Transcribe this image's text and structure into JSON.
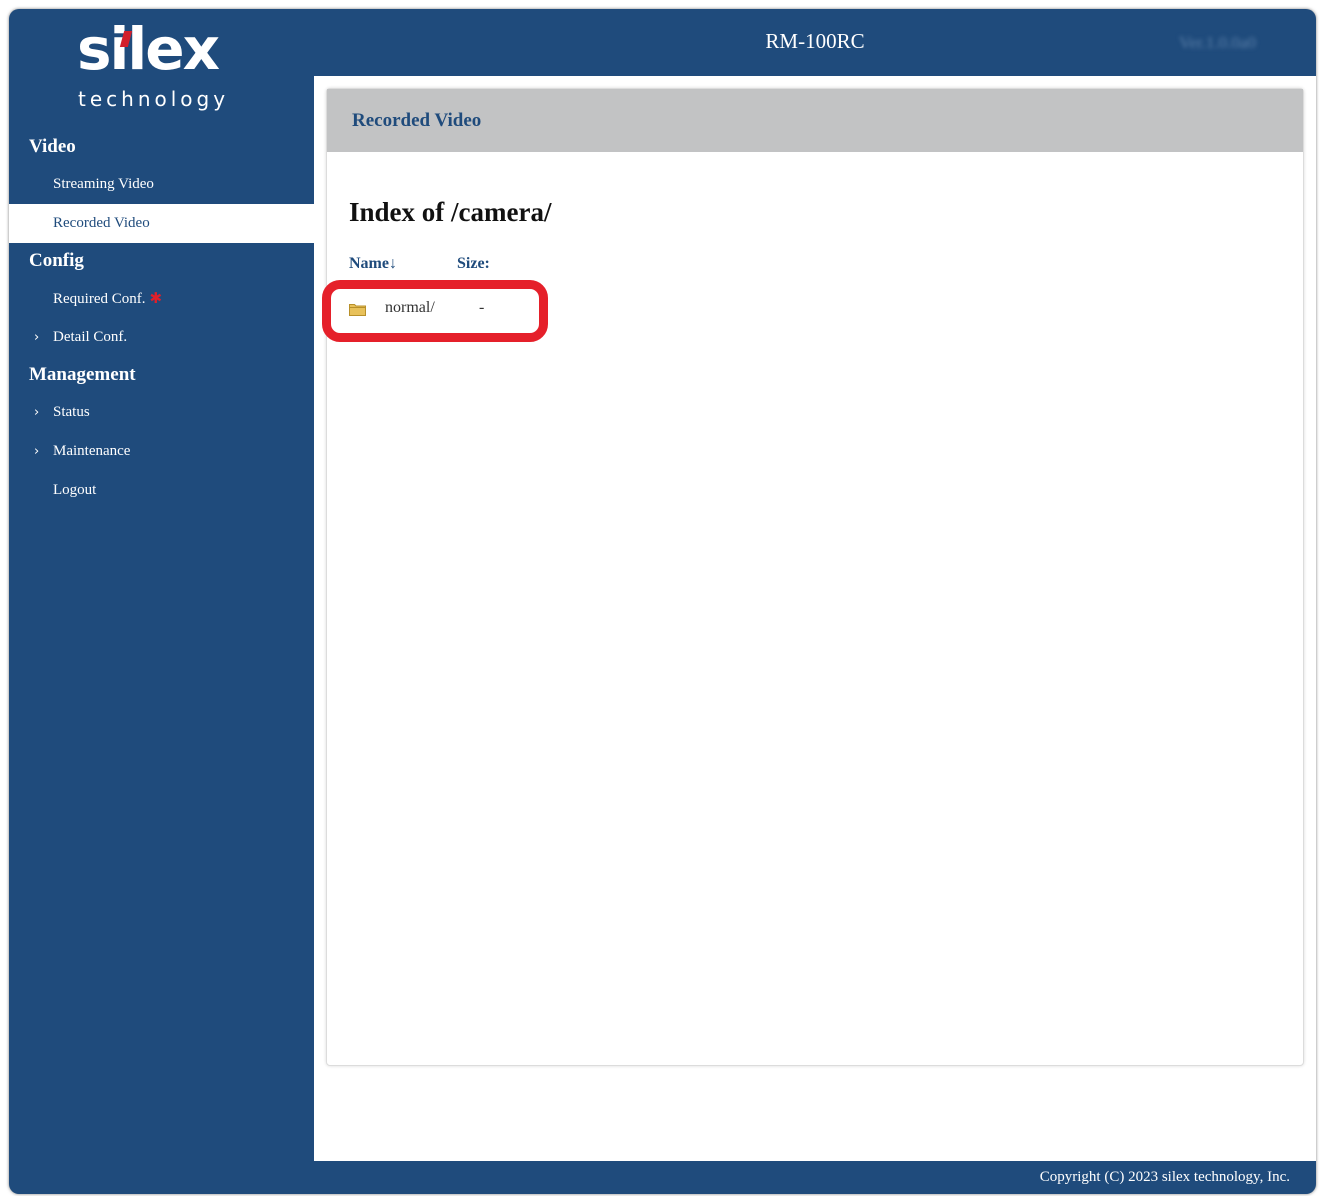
{
  "header": {
    "device_name": "RM-100RC",
    "version": "Ver.1.0.0a0"
  },
  "logo": {
    "brand": "silex",
    "sub": "technology"
  },
  "sidebar": {
    "sections": [
      {
        "title": "Video"
      },
      {
        "title": "Config"
      },
      {
        "title": "Management"
      }
    ],
    "items": [
      {
        "label": "Streaming Video"
      },
      {
        "label": "Recorded Video",
        "active": true
      },
      {
        "label": "Required Conf."
      },
      {
        "label": "Detail Conf.",
        "chevron": "›"
      },
      {
        "label": "Status",
        "chevron": "›"
      },
      {
        "label": "Maintenance",
        "chevron": "›"
      },
      {
        "label": "Logout"
      }
    ],
    "required_marker": "✱"
  },
  "panel": {
    "title": "Recorded Video",
    "index_title": "Index of /camera/",
    "columns": {
      "name": "Name↓",
      "size": "Size:"
    },
    "entries": [
      {
        "name": "normal/",
        "size": "-",
        "icon": "folder-icon"
      }
    ]
  },
  "footer": {
    "copyright": "Copyright (C) 2023 silex technology, Inc."
  },
  "colors": {
    "navy": "#1f4b7c",
    "panel_header": "#c2c3c4",
    "highlight": "#e5202a",
    "logo_accent": "#d21f2b"
  }
}
